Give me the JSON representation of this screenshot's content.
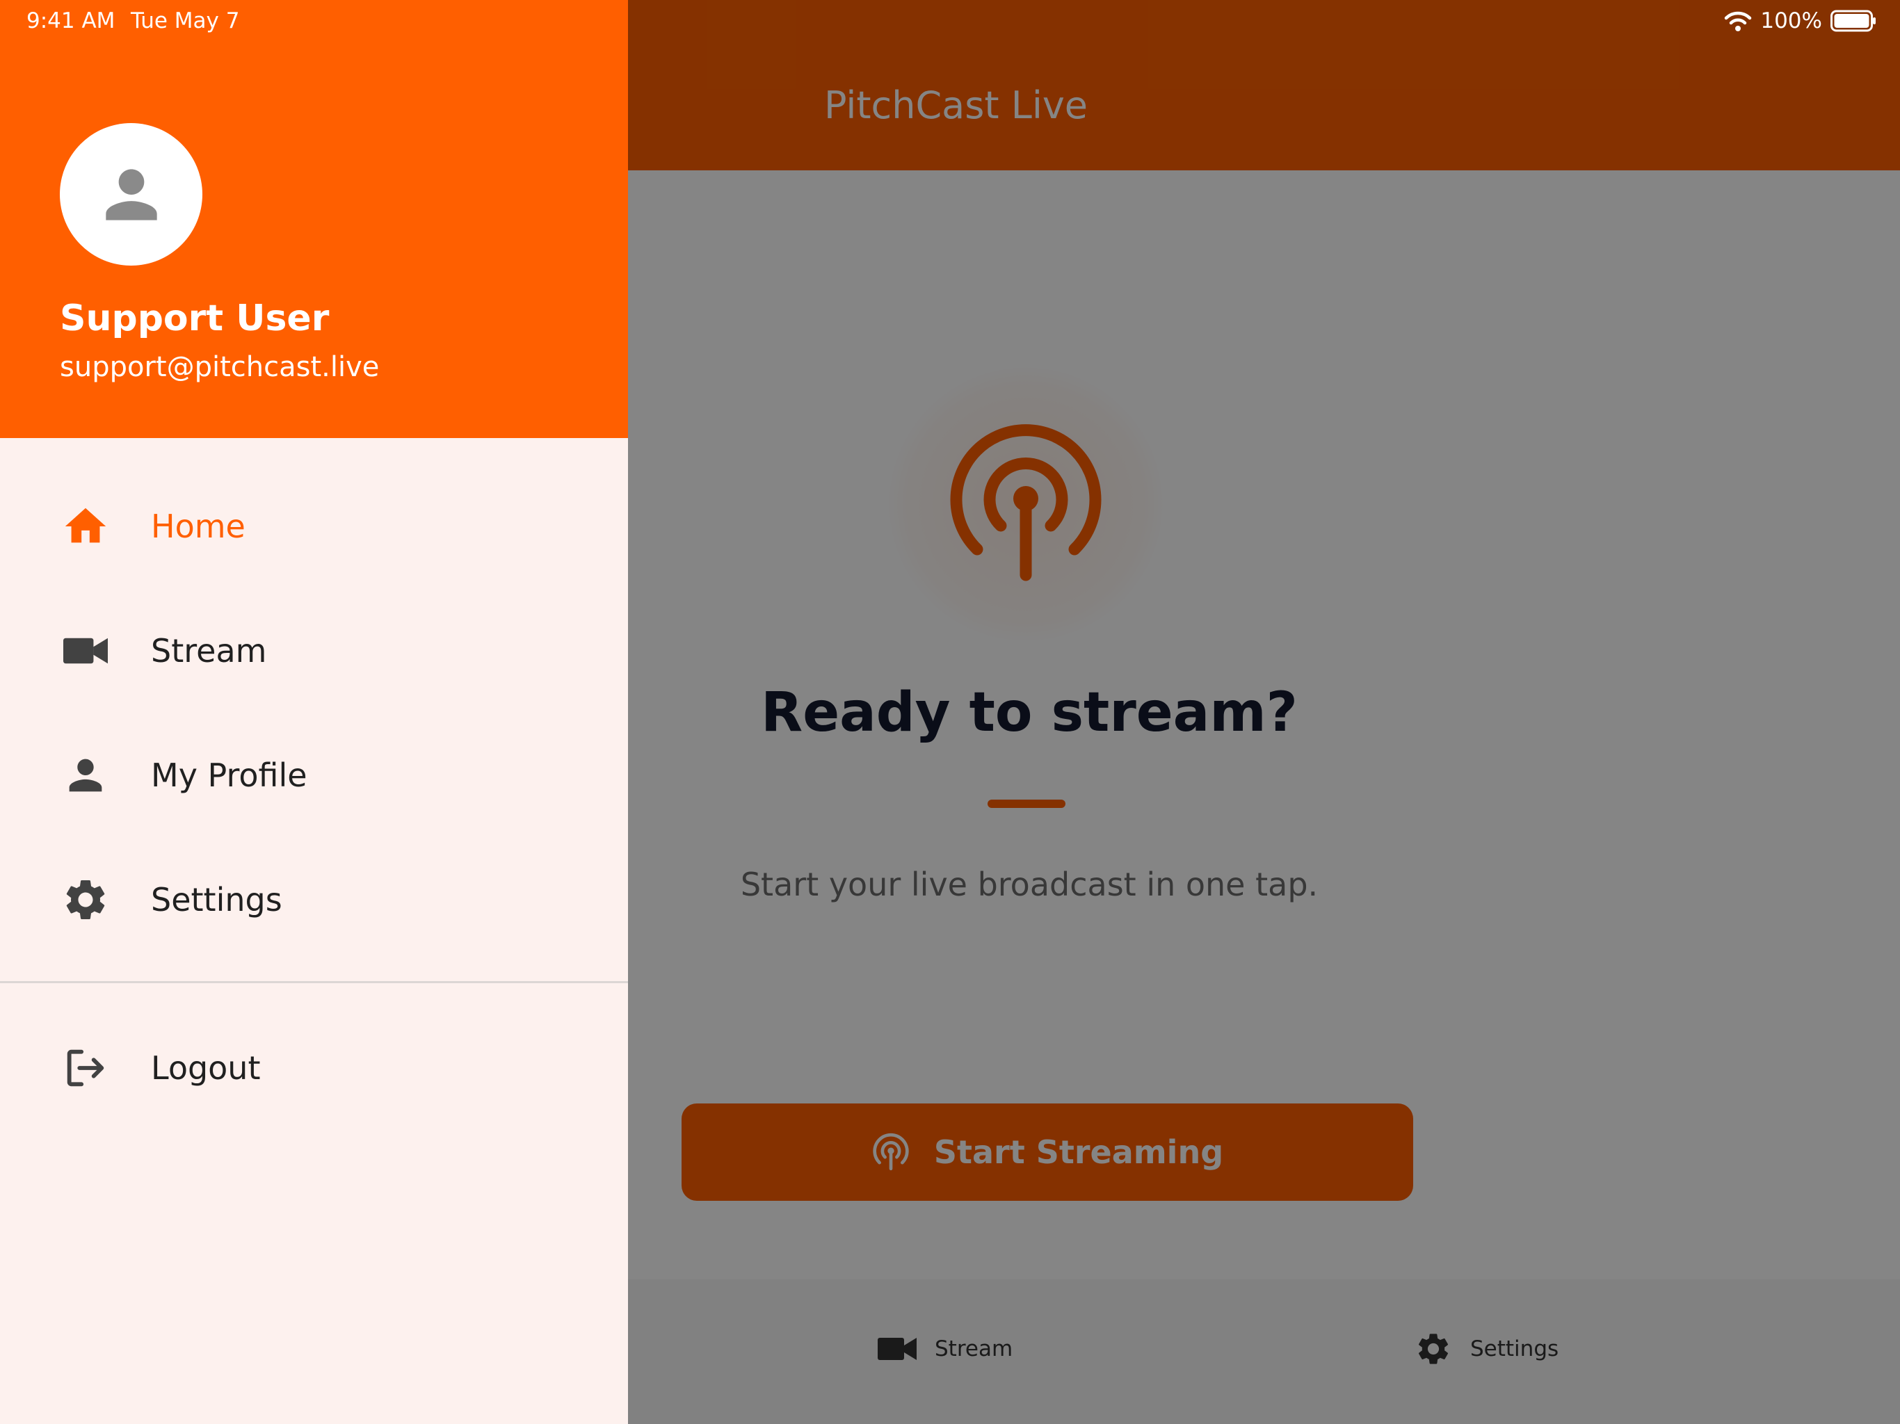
{
  "status_bar": {
    "time": "9:41 AM",
    "date": "Tue May 7",
    "battery": "100%"
  },
  "app": {
    "title": "PitchCast Live",
    "hero": {
      "title": "Ready to stream?",
      "subtitle": "Start your live broadcast in one tap."
    },
    "start_button": {
      "label": "Start Streaming"
    },
    "bottom_tabs": [
      {
        "label": "Stream",
        "icon": "video-camera-icon"
      },
      {
        "label": "Settings",
        "icon": "gear-icon"
      }
    ]
  },
  "drawer": {
    "user": {
      "name": "Support User",
      "email": "support@pitchcast.live"
    },
    "items": [
      {
        "label": "Home",
        "icon": "home-icon",
        "active": true
      },
      {
        "label": "Stream",
        "icon": "video-camera-icon",
        "active": false
      },
      {
        "label": "My Profile",
        "icon": "person-icon",
        "active": false
      },
      {
        "label": "Settings",
        "icon": "gear-icon",
        "active": false
      }
    ],
    "logout": {
      "label": "Logout",
      "icon": "logout-icon"
    }
  },
  "colors": {
    "brand": "#ff5f00",
    "drawer_bg": "#fdf1ee",
    "title_text": "#151a2e",
    "icon_gray": "#424242"
  }
}
